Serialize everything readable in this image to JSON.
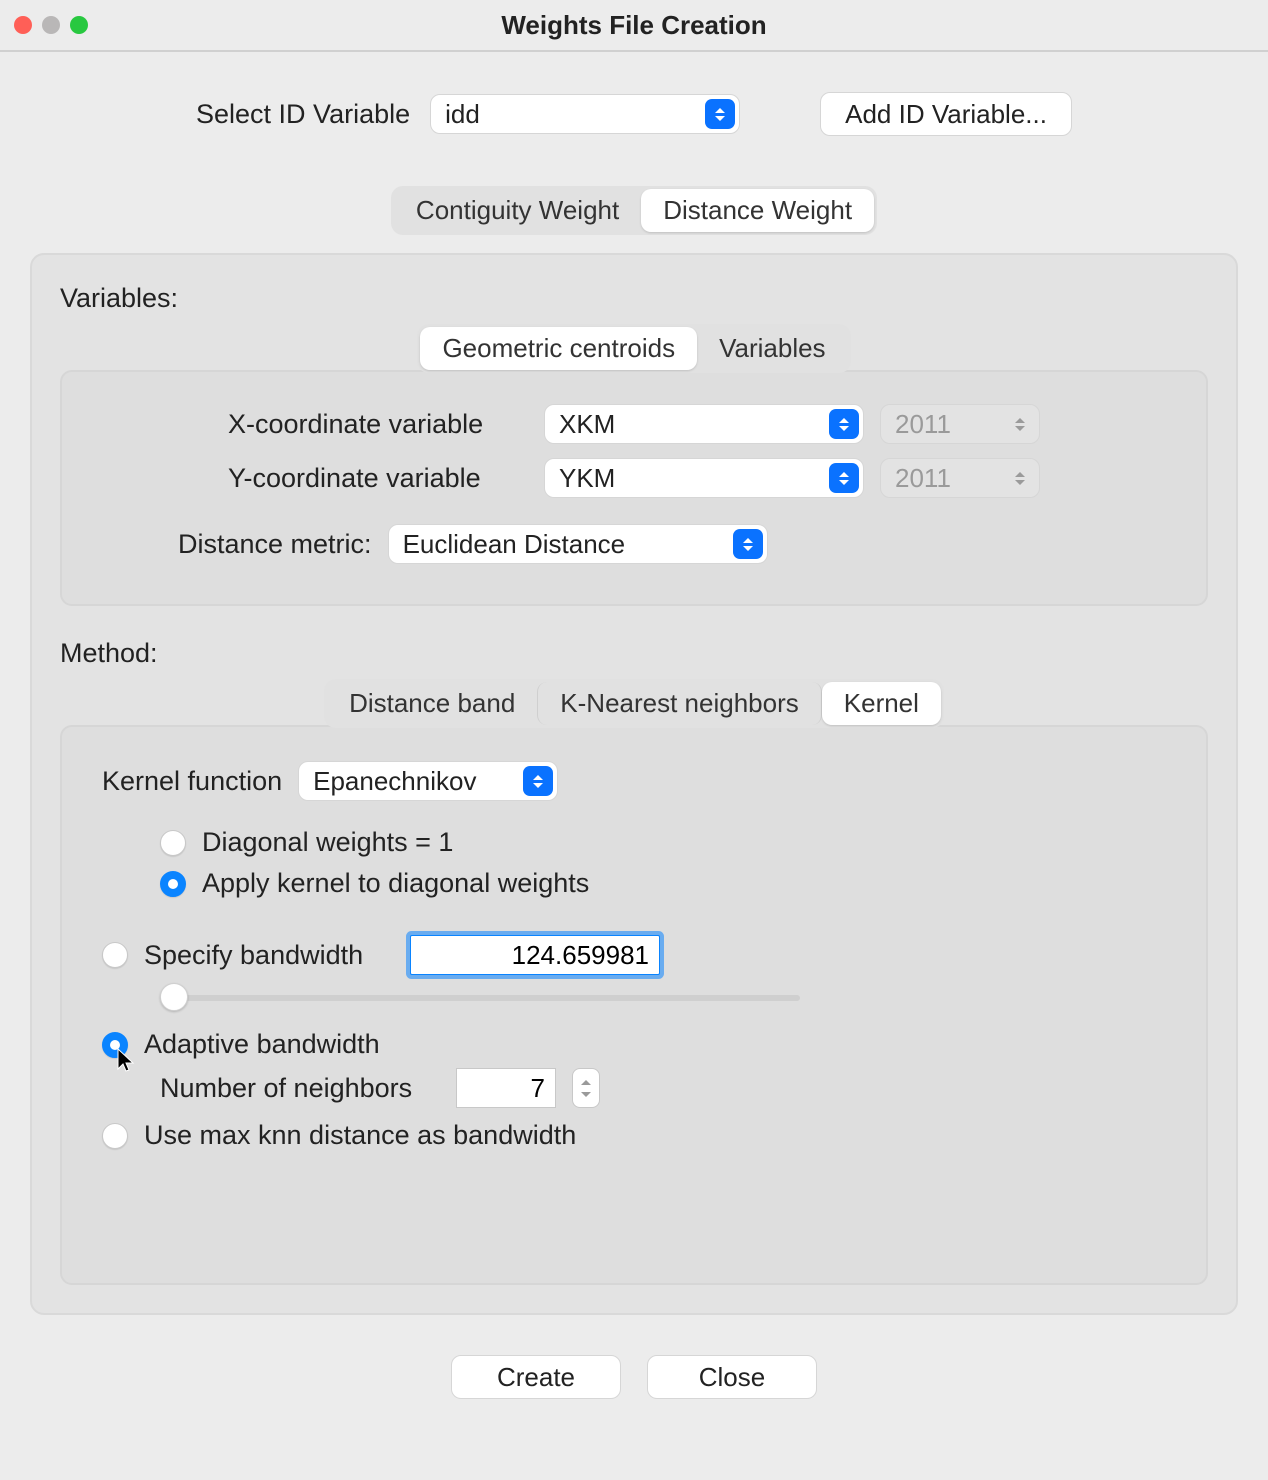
{
  "window": {
    "title": "Weights File Creation"
  },
  "idrow": {
    "label": "Select ID Variable",
    "value": "idd",
    "add_btn": "Add ID Variable..."
  },
  "top_tabs": {
    "contiguity": "Contiguity Weight",
    "distance": "Distance Weight"
  },
  "variables": {
    "heading": "Variables:",
    "sub_tabs": {
      "centroids": "Geometric centroids",
      "vars": "Variables"
    },
    "x_label": "X-coordinate variable",
    "x_value": "XKM",
    "x_year": "2011",
    "y_label": "Y-coordinate variable",
    "y_value": "YKM",
    "y_year": "2011",
    "metric_label": "Distance metric:",
    "metric_value": "Euclidean Distance"
  },
  "method": {
    "heading": "Method:",
    "tabs": {
      "band": "Distance band",
      "knn": "K-Nearest neighbors",
      "kernel": "Kernel"
    },
    "kfn_label": "Kernel function",
    "kfn_value": "Epanechnikov",
    "diag1": "Diagonal weights = 1",
    "diag2": "Apply kernel to diagonal weights",
    "spec_label": "Specify bandwidth",
    "spec_value": "124.659981",
    "adapt_label": "Adaptive bandwidth",
    "nn_label": "Number of neighbors",
    "nn_value": "7",
    "maxknn_label": "Use max knn distance as bandwidth"
  },
  "footer": {
    "create": "Create",
    "close": "Close"
  }
}
